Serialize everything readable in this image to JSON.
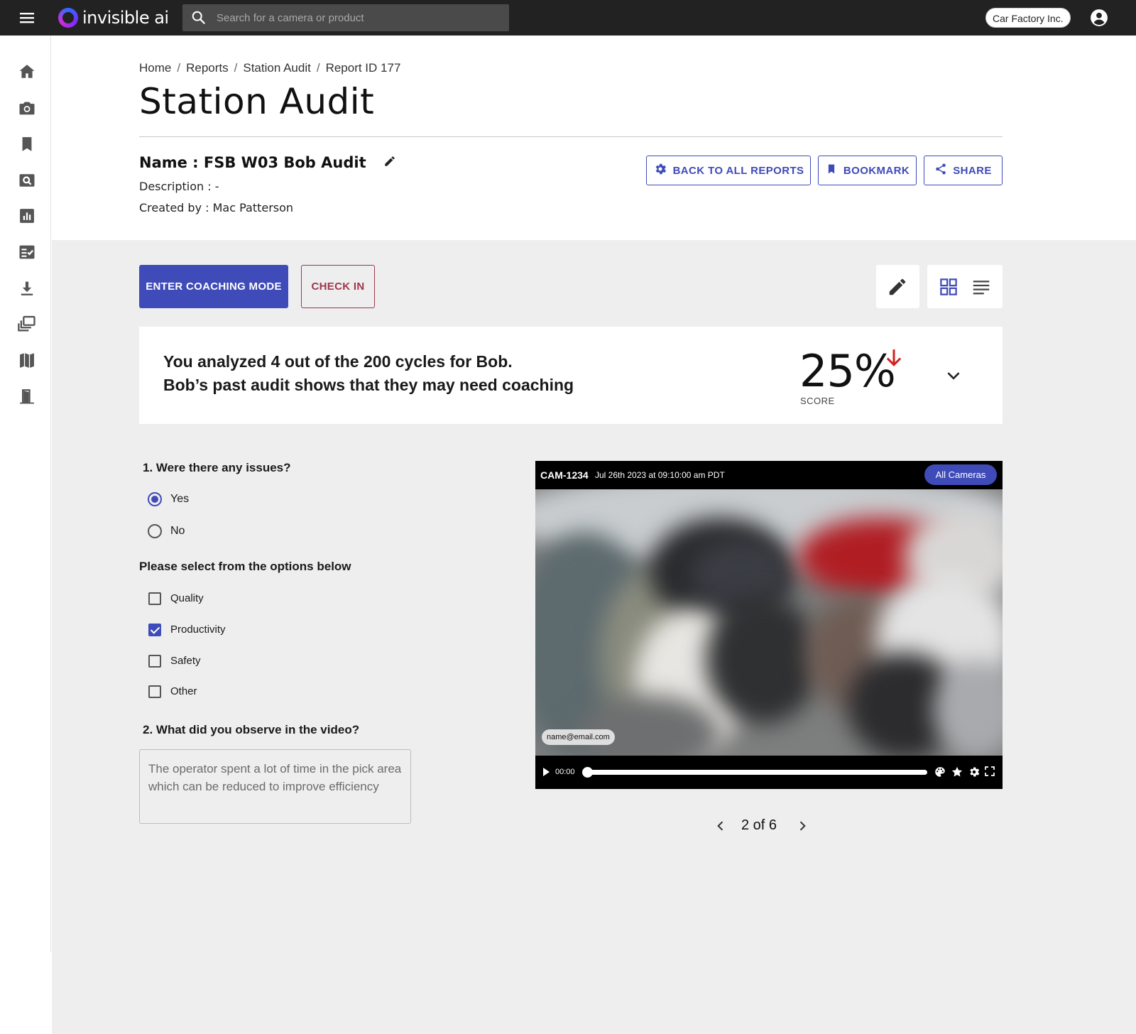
{
  "header": {
    "brand": "invisible ai",
    "search_placeholder": "Search for a camera or product",
    "org": "Car Factory Inc."
  },
  "sidebar": {
    "items": [
      {
        "icon": "home-icon"
      },
      {
        "icon": "camera-icon"
      },
      {
        "icon": "bookmark-icon"
      },
      {
        "icon": "search-video-icon"
      },
      {
        "icon": "analytics-icon"
      },
      {
        "icon": "checklist-icon"
      },
      {
        "icon": "download-icon"
      },
      {
        "icon": "library-icon"
      },
      {
        "icon": "map-icon"
      },
      {
        "icon": "exit-icon"
      }
    ]
  },
  "breadcrumb": [
    "Home",
    "Reports",
    "Station Audit",
    "Report ID 177"
  ],
  "page": {
    "title": "Station Audit",
    "name": "Name : FSB W03 Bob Audit",
    "description": "Description : -",
    "created_by": "Created by :  Mac Patterson"
  },
  "actions": {
    "back": "BACK TO ALL REPORTS",
    "bookmark": "BOOKMARK",
    "share": "SHARE",
    "coaching": "ENTER COACHING MODE",
    "checkin": "CHECK IN"
  },
  "summary": {
    "line1": "You analyzed 4 out of the 200 cycles for Bob.",
    "line2": "Bob’s past audit shows that they may need coaching",
    "score": "25%",
    "score_label": "SCORE",
    "trend": "down"
  },
  "form": {
    "q1": "1.  Were there any issues?",
    "q1_options": [
      {
        "label": "Yes",
        "selected": true
      },
      {
        "label": "No",
        "selected": false
      }
    ],
    "sub": "Please select from the options below",
    "checks": [
      {
        "label": "Quality",
        "checked": false
      },
      {
        "label": "Productivity",
        "checked": true
      },
      {
        "label": "Safety",
        "checked": false
      },
      {
        "label": "Other",
        "checked": false
      }
    ],
    "q2": "2.  What did you observe in the video?",
    "q2_answer": "The operator spent a lot of time in the pick area which can be reduced to improve efficiency"
  },
  "player": {
    "camera": "CAM-1234",
    "timestamp": "Jul 26th 2023 at 09:10:00 am PDT",
    "all_cameras": "All Cameras",
    "email": "name@email.com",
    "time": "00:00",
    "progress": 0
  },
  "pager": {
    "text": "2 of 6"
  },
  "colors": {
    "primary": "#3f4bb8",
    "checkin": "#a0354c",
    "trend_down": "#d32020",
    "topbar": "#222222"
  }
}
